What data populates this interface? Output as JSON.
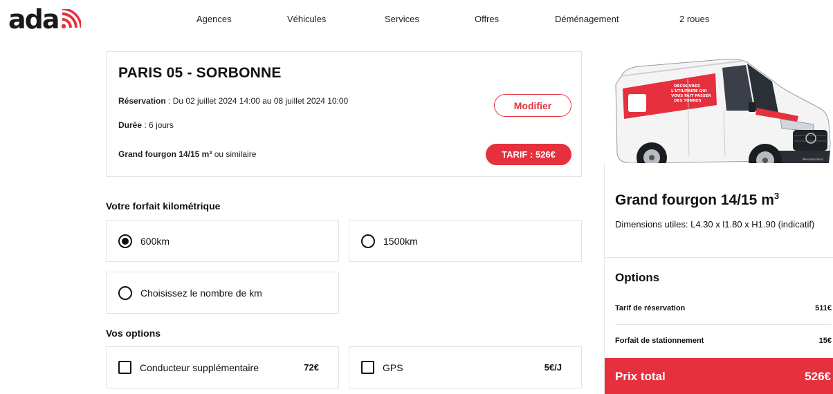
{
  "header": {
    "logo_text": "ada",
    "nav": [
      "Agences",
      "Véhicules",
      "Services",
      "Offres",
      "Déménagement",
      "2 roues"
    ]
  },
  "summary": {
    "agency": "PARIS 05 - SORBONNE",
    "reservation_label": "Réservation",
    "reservation_value": " : Du 02 juillet 2024 14:00 au 08 juillet 2024 10:00",
    "duration_label": "Durée",
    "duration_value": " : 6 jours",
    "vehicle_bold": "Grand fourgon 14/15 m³",
    "vehicle_suffix": " ou similaire",
    "modify_label": "Modifier",
    "tarif_label": "TARIF : 526€"
  },
  "mileage": {
    "title": "Votre forfait kilométrique",
    "options": [
      {
        "label": "600km",
        "selected": true
      },
      {
        "label": "1500km",
        "selected": false
      },
      {
        "label": "Choisissez le nombre de km",
        "selected": false
      }
    ]
  },
  "options": {
    "title": "Vos options",
    "items": [
      {
        "label": "Conducteur supplémentaire",
        "price": "72€",
        "checked": false
      },
      {
        "label": "GPS",
        "price": "5€/J",
        "checked": false
      }
    ]
  },
  "vehicle": {
    "name": "Grand fourgon 14/15 m",
    "name_sup": "3",
    "dimensions": "Dimensions utiles: L4.30 x l1.80 x H1.90 (indicatif)",
    "van_banner_lines": [
      "DÉCOUVREZ",
      "L'UTILITAIRE QUI",
      "VOUS FAIT PASSER",
      "DES TONNES"
    ],
    "brand": "Mercedes-Benz"
  },
  "pricing": {
    "title": "Options",
    "rows": [
      {
        "label": "Tarif de réservation",
        "value": "511€"
      },
      {
        "label": "Forfait de stationnement",
        "value": "15€"
      }
    ],
    "total_label": "Prix total",
    "total_value": "526€"
  },
  "colors": {
    "accent": "#e6303e",
    "text": "#111111",
    "border": "#e4e4e4"
  }
}
